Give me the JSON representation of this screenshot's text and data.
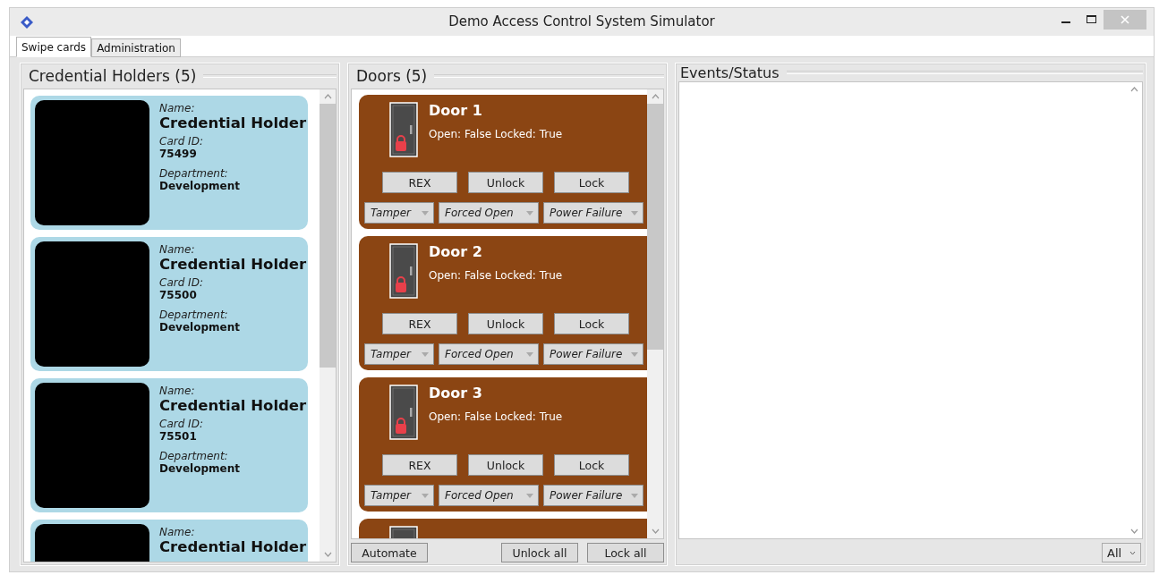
{
  "window": {
    "title": "Demo Access Control System Simulator"
  },
  "tabs": [
    {
      "label": "Swipe cards",
      "selected": true
    },
    {
      "label": "Administration",
      "selected": false
    }
  ],
  "credential_holders": {
    "title": "Credential Holders (5)",
    "items": [
      {
        "name_label": "Name:",
        "name": "Credential Holder",
        "card_id_label": "Card ID:",
        "card_id": "75499",
        "department_label": "Department:",
        "department": "Development"
      },
      {
        "name_label": "Name:",
        "name": "Credential Holder",
        "card_id_label": "Card ID:",
        "card_id": "75500",
        "department_label": "Department:",
        "department": "Development"
      },
      {
        "name_label": "Name:",
        "name": "Credential Holder",
        "card_id_label": "Card ID:",
        "card_id": "75501",
        "department_label": "Department:",
        "department": "Development"
      },
      {
        "name_label": "Name:",
        "name": "Credential Holder"
      }
    ]
  },
  "doors": {
    "title": "Doors (5)",
    "items": [
      {
        "kind": "full",
        "name": "Door 1",
        "status": "Open: False Locked: True",
        "locked": true,
        "buttons": [
          "REX",
          "Unlock",
          "Lock"
        ],
        "dropdowns": [
          "Tamper",
          "Forced Open",
          "Power Failure"
        ]
      },
      {
        "kind": "full",
        "name": "Door 2",
        "status": "Open: False Locked: True",
        "locked": true,
        "buttons": [
          "REX",
          "Unlock",
          "Lock"
        ],
        "dropdowns": [
          "Tamper",
          "Forced Open",
          "Power Failure"
        ]
      },
      {
        "kind": "full",
        "name": "Door 3",
        "status": "Open: False Locked: True",
        "locked": true,
        "buttons": [
          "REX",
          "Unlock",
          "Lock"
        ],
        "dropdowns": [
          "Tamper",
          "Forced Open",
          "Power Failure"
        ]
      },
      {
        "kind": "partial"
      }
    ],
    "left_buttons": [
      "Automate"
    ],
    "right_buttons": [
      "Unlock all",
      "Lock all"
    ]
  },
  "events": {
    "title": "Events/Status",
    "filter": "All"
  }
}
